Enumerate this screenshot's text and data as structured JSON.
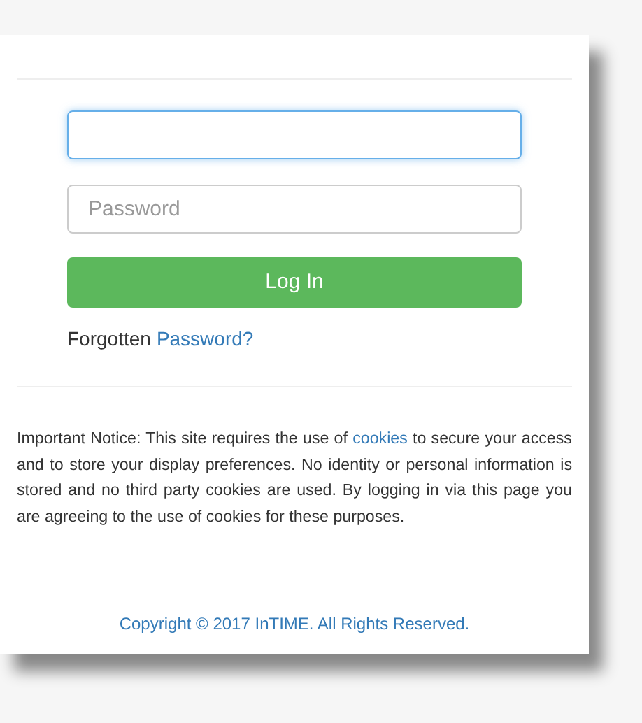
{
  "login_form": {
    "fields": [
      {
        "focused": true
      },
      {
        "placeholder": "Password",
        "focused": false
      }
    ],
    "submit_button": {
      "label": "Log In"
    },
    "forgot": {
      "text": "Forgotten",
      "link": "Password?"
    }
  },
  "notice": {
    "before": "Important Notice: This site requires the use of",
    "link": "cookies",
    "after": "to secure your access and to store your display preferences. No identity or personal information is stored and no third party cookies are used. By logging in via this page you are agreeing to the use of cookies for these purposes."
  },
  "footer": {
    "copyright": "Copyright © 2017 InTIME. All Rights Reserved."
  }
}
